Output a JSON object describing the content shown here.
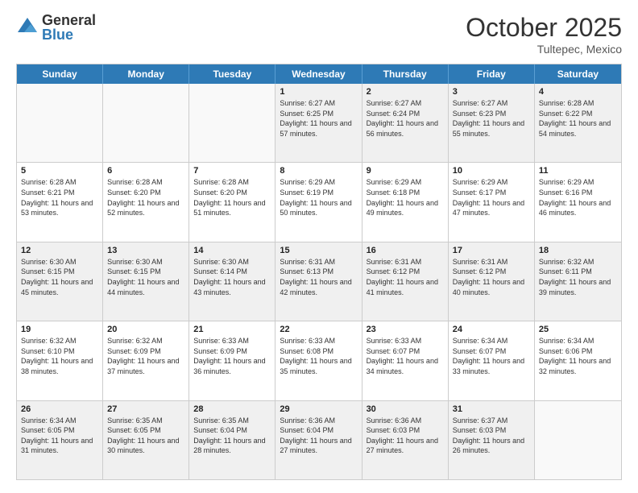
{
  "logo": {
    "general": "General",
    "blue": "Blue"
  },
  "header": {
    "month": "October 2025",
    "location": "Tultepec, Mexico"
  },
  "weekdays": [
    "Sunday",
    "Monday",
    "Tuesday",
    "Wednesday",
    "Thursday",
    "Friday",
    "Saturday"
  ],
  "rows": [
    [
      {
        "day": "",
        "empty": true
      },
      {
        "day": "",
        "empty": true
      },
      {
        "day": "",
        "empty": true
      },
      {
        "day": "1",
        "sunrise": "6:27 AM",
        "sunset": "6:25 PM",
        "daylight": "11 hours and 57 minutes."
      },
      {
        "day": "2",
        "sunrise": "6:27 AM",
        "sunset": "6:24 PM",
        "daylight": "11 hours and 56 minutes."
      },
      {
        "day": "3",
        "sunrise": "6:27 AM",
        "sunset": "6:23 PM",
        "daylight": "11 hours and 55 minutes."
      },
      {
        "day": "4",
        "sunrise": "6:28 AM",
        "sunset": "6:22 PM",
        "daylight": "11 hours and 54 minutes."
      }
    ],
    [
      {
        "day": "5",
        "sunrise": "6:28 AM",
        "sunset": "6:21 PM",
        "daylight": "11 hours and 53 minutes."
      },
      {
        "day": "6",
        "sunrise": "6:28 AM",
        "sunset": "6:20 PM",
        "daylight": "11 hours and 52 minutes."
      },
      {
        "day": "7",
        "sunrise": "6:28 AM",
        "sunset": "6:20 PM",
        "daylight": "11 hours and 51 minutes."
      },
      {
        "day": "8",
        "sunrise": "6:29 AM",
        "sunset": "6:19 PM",
        "daylight": "11 hours and 50 minutes."
      },
      {
        "day": "9",
        "sunrise": "6:29 AM",
        "sunset": "6:18 PM",
        "daylight": "11 hours and 49 minutes."
      },
      {
        "day": "10",
        "sunrise": "6:29 AM",
        "sunset": "6:17 PM",
        "daylight": "11 hours and 47 minutes."
      },
      {
        "day": "11",
        "sunrise": "6:29 AM",
        "sunset": "6:16 PM",
        "daylight": "11 hours and 46 minutes."
      }
    ],
    [
      {
        "day": "12",
        "sunrise": "6:30 AM",
        "sunset": "6:15 PM",
        "daylight": "11 hours and 45 minutes."
      },
      {
        "day": "13",
        "sunrise": "6:30 AM",
        "sunset": "6:15 PM",
        "daylight": "11 hours and 44 minutes."
      },
      {
        "day": "14",
        "sunrise": "6:30 AM",
        "sunset": "6:14 PM",
        "daylight": "11 hours and 43 minutes."
      },
      {
        "day": "15",
        "sunrise": "6:31 AM",
        "sunset": "6:13 PM",
        "daylight": "11 hours and 42 minutes."
      },
      {
        "day": "16",
        "sunrise": "6:31 AM",
        "sunset": "6:12 PM",
        "daylight": "11 hours and 41 minutes."
      },
      {
        "day": "17",
        "sunrise": "6:31 AM",
        "sunset": "6:12 PM",
        "daylight": "11 hours and 40 minutes."
      },
      {
        "day": "18",
        "sunrise": "6:32 AM",
        "sunset": "6:11 PM",
        "daylight": "11 hours and 39 minutes."
      }
    ],
    [
      {
        "day": "19",
        "sunrise": "6:32 AM",
        "sunset": "6:10 PM",
        "daylight": "11 hours and 38 minutes."
      },
      {
        "day": "20",
        "sunrise": "6:32 AM",
        "sunset": "6:09 PM",
        "daylight": "11 hours and 37 minutes."
      },
      {
        "day": "21",
        "sunrise": "6:33 AM",
        "sunset": "6:09 PM",
        "daylight": "11 hours and 36 minutes."
      },
      {
        "day": "22",
        "sunrise": "6:33 AM",
        "sunset": "6:08 PM",
        "daylight": "11 hours and 35 minutes."
      },
      {
        "day": "23",
        "sunrise": "6:33 AM",
        "sunset": "6:07 PM",
        "daylight": "11 hours and 34 minutes."
      },
      {
        "day": "24",
        "sunrise": "6:34 AM",
        "sunset": "6:07 PM",
        "daylight": "11 hours and 33 minutes."
      },
      {
        "day": "25",
        "sunrise": "6:34 AM",
        "sunset": "6:06 PM",
        "daylight": "11 hours and 32 minutes."
      }
    ],
    [
      {
        "day": "26",
        "sunrise": "6:34 AM",
        "sunset": "6:05 PM",
        "daylight": "11 hours and 31 minutes."
      },
      {
        "day": "27",
        "sunrise": "6:35 AM",
        "sunset": "6:05 PM",
        "daylight": "11 hours and 30 minutes."
      },
      {
        "day": "28",
        "sunrise": "6:35 AM",
        "sunset": "6:04 PM",
        "daylight": "11 hours and 28 minutes."
      },
      {
        "day": "29",
        "sunrise": "6:36 AM",
        "sunset": "6:04 PM",
        "daylight": "11 hours and 27 minutes."
      },
      {
        "day": "30",
        "sunrise": "6:36 AM",
        "sunset": "6:03 PM",
        "daylight": "11 hours and 27 minutes."
      },
      {
        "day": "31",
        "sunrise": "6:37 AM",
        "sunset": "6:03 PM",
        "daylight": "11 hours and 26 minutes."
      },
      {
        "day": "",
        "empty": true
      }
    ]
  ]
}
